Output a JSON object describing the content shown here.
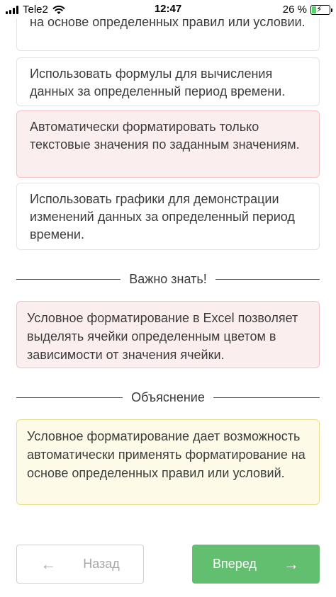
{
  "status_bar": {
    "carrier": "Tele2",
    "time": "12:47",
    "battery": "26 %",
    "battery_level": 0.26
  },
  "options": [
    {
      "text": "на основе определенных правил или условий.",
      "state": "default"
    },
    {
      "text": "Использовать формулы для вычисления данных за определенный период времени.",
      "state": "default"
    },
    {
      "text": "Автоматически форматировать только текстовые значения по заданным значениям.",
      "state": "selected-wrong"
    },
    {
      "text": "Использовать графики для демонстрации изменений данных за определенный период времени.",
      "state": "default"
    }
  ],
  "important": {
    "heading": "Важно знать!",
    "text": "Условное форматирование в Excel позволяет выделять ячейки определенным цветом в зависимости от значения ячейки."
  },
  "explanation": {
    "heading": "Объяснение",
    "text": "Условное форматирование дает возможность автоматически применять форматирование на основе определенных правил или условий."
  },
  "nav": {
    "back_label": "Назад",
    "next_label": "Вперед"
  },
  "colors": {
    "wrong_bg": "#fbeeee",
    "explanation_bg": "#fdfbe8",
    "next_button": "#63bf70"
  }
}
